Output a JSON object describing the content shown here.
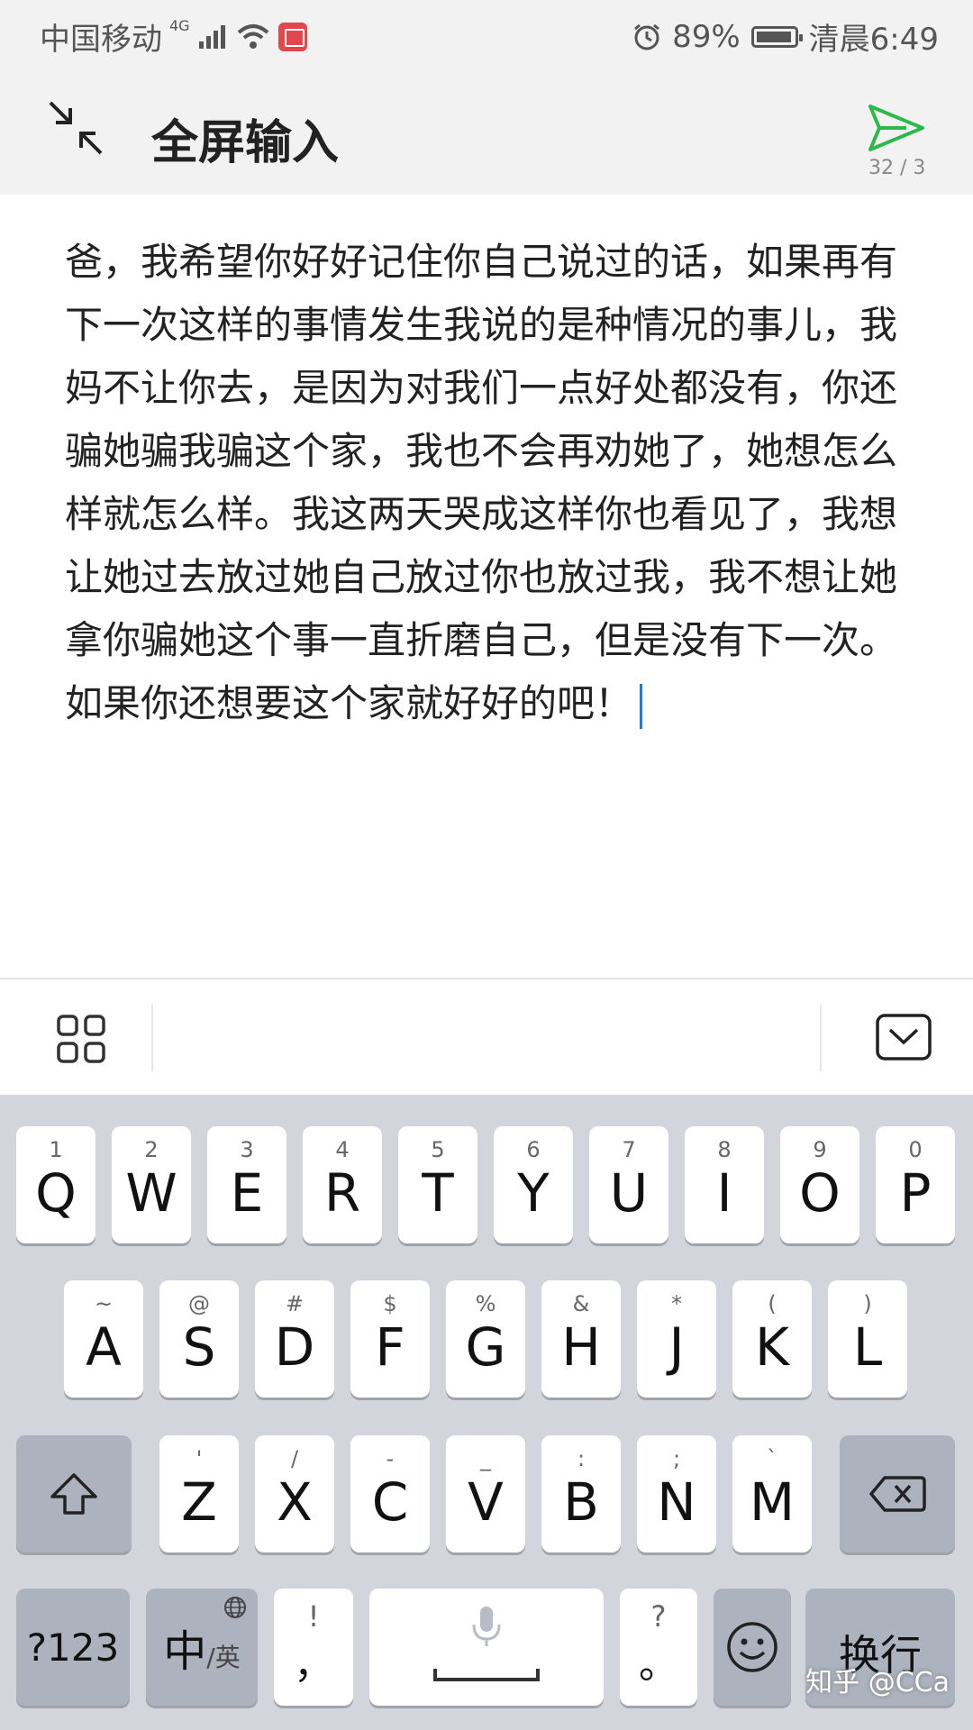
{
  "status_bar": {
    "carrier": "中国移动",
    "network": "4G",
    "battery": "89%",
    "time": "清晨6:49"
  },
  "header": {
    "title": "全屏输入",
    "counter": "32 / 3",
    "accent_color": "#2db84c"
  },
  "editor": {
    "text": "爸，我希望你好好记住你自己说过的话，如果再有下一次这样的事情发生我说的是种情况的事儿，我妈不让你去，是因为对我们一点好处都没有，你还骗她骗我骗这个家，我也不会再劝她了，她想怎么样就怎么样。我这两天哭成这样你也看见了，我想让她过去放过她自己放过你也放过我，我不想让她拿你骗她这个事一直折磨自己，但是没有下一次。如果你还想要这个家就好好的吧！"
  },
  "keyboard": {
    "row1": [
      {
        "hint": "1",
        "key": "Q"
      },
      {
        "hint": "2",
        "key": "W"
      },
      {
        "hint": "3",
        "key": "E"
      },
      {
        "hint": "4",
        "key": "R"
      },
      {
        "hint": "5",
        "key": "T"
      },
      {
        "hint": "6",
        "key": "Y"
      },
      {
        "hint": "7",
        "key": "U"
      },
      {
        "hint": "8",
        "key": "I"
      },
      {
        "hint": "9",
        "key": "O"
      },
      {
        "hint": "0",
        "key": "P"
      }
    ],
    "row2": [
      {
        "hint": "~",
        "key": "A"
      },
      {
        "hint": "@",
        "key": "S"
      },
      {
        "hint": "#",
        "key": "D"
      },
      {
        "hint": "$",
        "key": "F"
      },
      {
        "hint": "%",
        "key": "G"
      },
      {
        "hint": "&",
        "key": "H"
      },
      {
        "hint": "*",
        "key": "J"
      },
      {
        "hint": "(",
        "key": "K"
      },
      {
        "hint": ")",
        "key": "L"
      }
    ],
    "row3": [
      {
        "hint": "'",
        "key": "Z"
      },
      {
        "hint": "/",
        "key": "X"
      },
      {
        "hint": "-",
        "key": "C"
      },
      {
        "hint": "_",
        "key": "V"
      },
      {
        "hint": ":",
        "key": "B"
      },
      {
        "hint": ";",
        "key": "N"
      },
      {
        "hint": "`",
        "key": "M"
      }
    ],
    "numbers_key": "?123",
    "lang_main": "中",
    "lang_sub": "/英",
    "comma_hint": "!",
    "comma_key": "，",
    "period_hint": "?",
    "period_key": "。",
    "enter_key": "换行"
  },
  "watermark": "知乎 @CCa"
}
